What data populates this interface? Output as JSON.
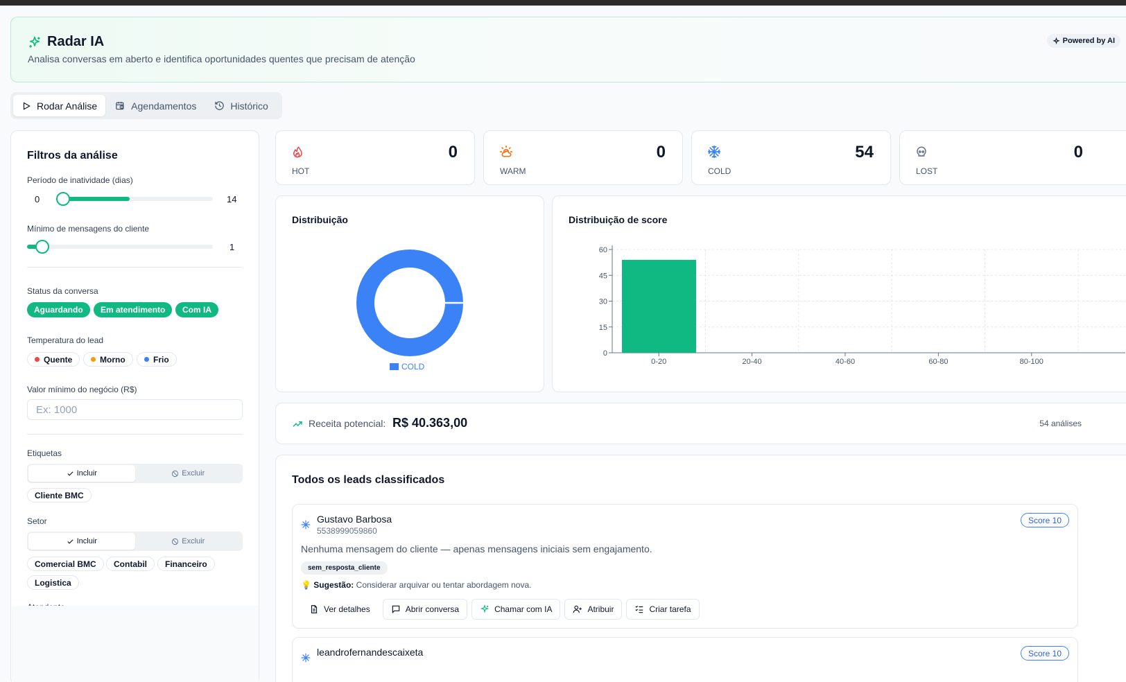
{
  "header": {
    "title": "Radar IA",
    "subtitle": "Analisa conversas em aberto e identifica oportunidades quentes que precisam de atenção",
    "badge": "Powered by AI",
    "accent_color": "#10b981"
  },
  "tabs": [
    {
      "label": "Rodar Análise",
      "icon": "play-icon",
      "active": true
    },
    {
      "label": "Agendamentos",
      "icon": "calendar-clock-icon",
      "active": false
    },
    {
      "label": "Histórico",
      "icon": "history-icon",
      "active": false
    }
  ],
  "filters": {
    "title": "Filtros da análise",
    "inactivity": {
      "label": "Período de inatividade (dias)",
      "min_value": "0",
      "max_value": "14"
    },
    "min_messages": {
      "label": "Mínimo de mensagens do cliente",
      "value": "1"
    },
    "status": {
      "label": "Status da conversa",
      "options": [
        "Aguardando",
        "Em atendimento",
        "Com IA"
      ]
    },
    "temperature": {
      "label": "Temperatura do lead",
      "options": [
        {
          "label": "Quente",
          "color": "#ef4444"
        },
        {
          "label": "Morno",
          "color": "#f59e0b"
        },
        {
          "label": "Frio",
          "color": "#3b82f6"
        }
      ]
    },
    "min_value": {
      "label": "Valor mínimo do negócio (R$)",
      "placeholder": "Ex: 1000"
    },
    "tags": {
      "label": "Etiquetas",
      "include": "Incluir",
      "exclude": "Excluir",
      "items": [
        "Cliente BMC"
      ]
    },
    "sector": {
      "label": "Setor",
      "include": "Incluir",
      "exclude": "Excluir",
      "items": [
        "Comercial BMC",
        "Contabil",
        "Financeiro",
        "Logistica"
      ]
    },
    "next_label": "Atendente"
  },
  "stats": [
    {
      "label": "HOT",
      "value": "0",
      "icon": "flame-icon",
      "color": "#ef4444"
    },
    {
      "label": "WARM",
      "value": "0",
      "icon": "sun-cloud-icon",
      "color": "#f97316"
    },
    {
      "label": "COLD",
      "value": "54",
      "icon": "snowflake-icon",
      "color": "#3b82f6"
    },
    {
      "label": "LOST",
      "value": "0",
      "icon": "skull-icon",
      "color": "#64748b"
    }
  ],
  "distribution": {
    "title": "Distribuição"
  },
  "score_chart": {
    "title": "Distribuição de score"
  },
  "chart_data": [
    {
      "type": "pie",
      "title": "Distribuição",
      "categories": [
        "COLD"
      ],
      "values": [
        54
      ],
      "colors": [
        "#3b82f6"
      ],
      "legend": "bottom"
    },
    {
      "type": "bar",
      "title": "Distribuição de score",
      "categories": [
        "0-20",
        "20-40",
        "40-60",
        "60-80",
        "80-100"
      ],
      "values": [
        54,
        0,
        0,
        0,
        0
      ],
      "yticks": [
        "0",
        "15",
        "30",
        "45",
        "60"
      ],
      "ylim": [
        0,
        60
      ],
      "grid": true,
      "color": "#10b981"
    }
  ],
  "revenue": {
    "label": "Receita potencial:",
    "value": "R$ 40.363,00",
    "count": "54 análises"
  },
  "leads": {
    "title": "Todos os leads classificados",
    "items": [
      {
        "name": "Gustavo Barbosa",
        "phone": "5538999059860",
        "score": "Score 10",
        "description": "Nenhuma mensagem do cliente — apenas mensagens iniciais sem engajamento.",
        "tag": "sem_resposta_cliente",
        "suggestion_label": "Sugestão:",
        "suggestion": "Considerar arquivar ou tentar abordagem nova."
      },
      {
        "name": "leandrofernandescaixeta",
        "score": "Score 10"
      }
    ],
    "actions": [
      "Ver detalhes",
      "Abrir conversa",
      "Chamar com IA",
      "Atribuir",
      "Criar tarefa"
    ]
  }
}
